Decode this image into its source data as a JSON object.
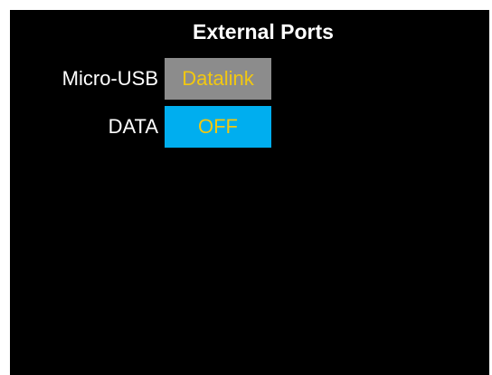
{
  "title": "External Ports",
  "ports": {
    "micro_usb": {
      "label": "Micro-USB",
      "value": "Datalink"
    },
    "data": {
      "label": "DATA",
      "value": "OFF"
    }
  },
  "colors": {
    "background": "#000000",
    "label_text": "#ffffff",
    "value_text": "#f2c811",
    "usb_box": "#8c8c8c",
    "data_box": "#00aeef"
  }
}
